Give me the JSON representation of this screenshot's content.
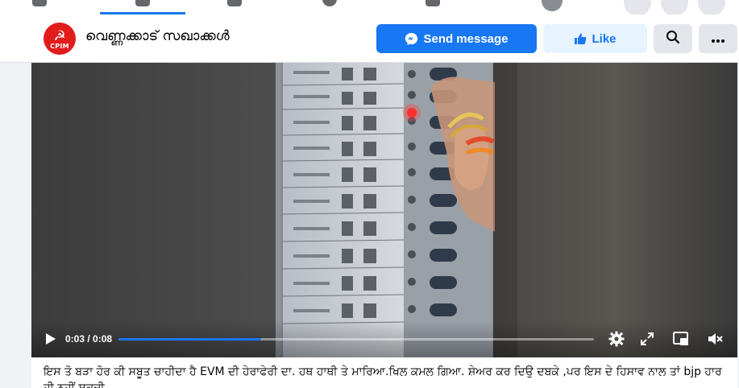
{
  "page": {
    "name": "വെണ്ണക്കാട് സഖാക്കൾ",
    "logo_text": "CPIM"
  },
  "actions": {
    "send_message": "Send message",
    "like": "Like"
  },
  "icons": {
    "send": "messenger-icon",
    "like": "thumbs-up-icon",
    "search": "search-icon",
    "more": "more-icon",
    "play": "play-icon",
    "settings": "gear-icon",
    "fullscreen": "expand-icon",
    "pip": "picture-in-picture-icon",
    "volume": "volume-muted-icon"
  },
  "video": {
    "current_time": "0:03",
    "duration": "0:08",
    "time_label": "0:03 / 0:08",
    "progress": 0.3
  },
  "post": {
    "caption": "ਇਸ ਤੋ ਬੜਾ ਹੋਰ ਕੀ ਸਬੂਤ ਚਾਹੀਦਾ ਹੈ EVM ਦੀ ਹੇਰਾਫੇਰੀ ਦਾ. ਹਥ ਹਾਥੀ ਤੇ ਮਾਰਿਆ.ਖਿਲ ਕਮਲ ਗਿਆ. ਸ਼ੇਅਰ ਕਰ ਦਿਉ ਦਬਕੇ ,ਪਰ ਇਸ ਦੇ ਹਿਸਾਵ ਨਾਲ ਤਾਂ bjp ਹਾਰ ਹੀ ਨਹੀਂ ਸਕਦੀ"
  },
  "colors": {
    "accent": "#1877f2",
    "like_bg": "#e7f3ff",
    "logo_red": "#e21b1b"
  }
}
